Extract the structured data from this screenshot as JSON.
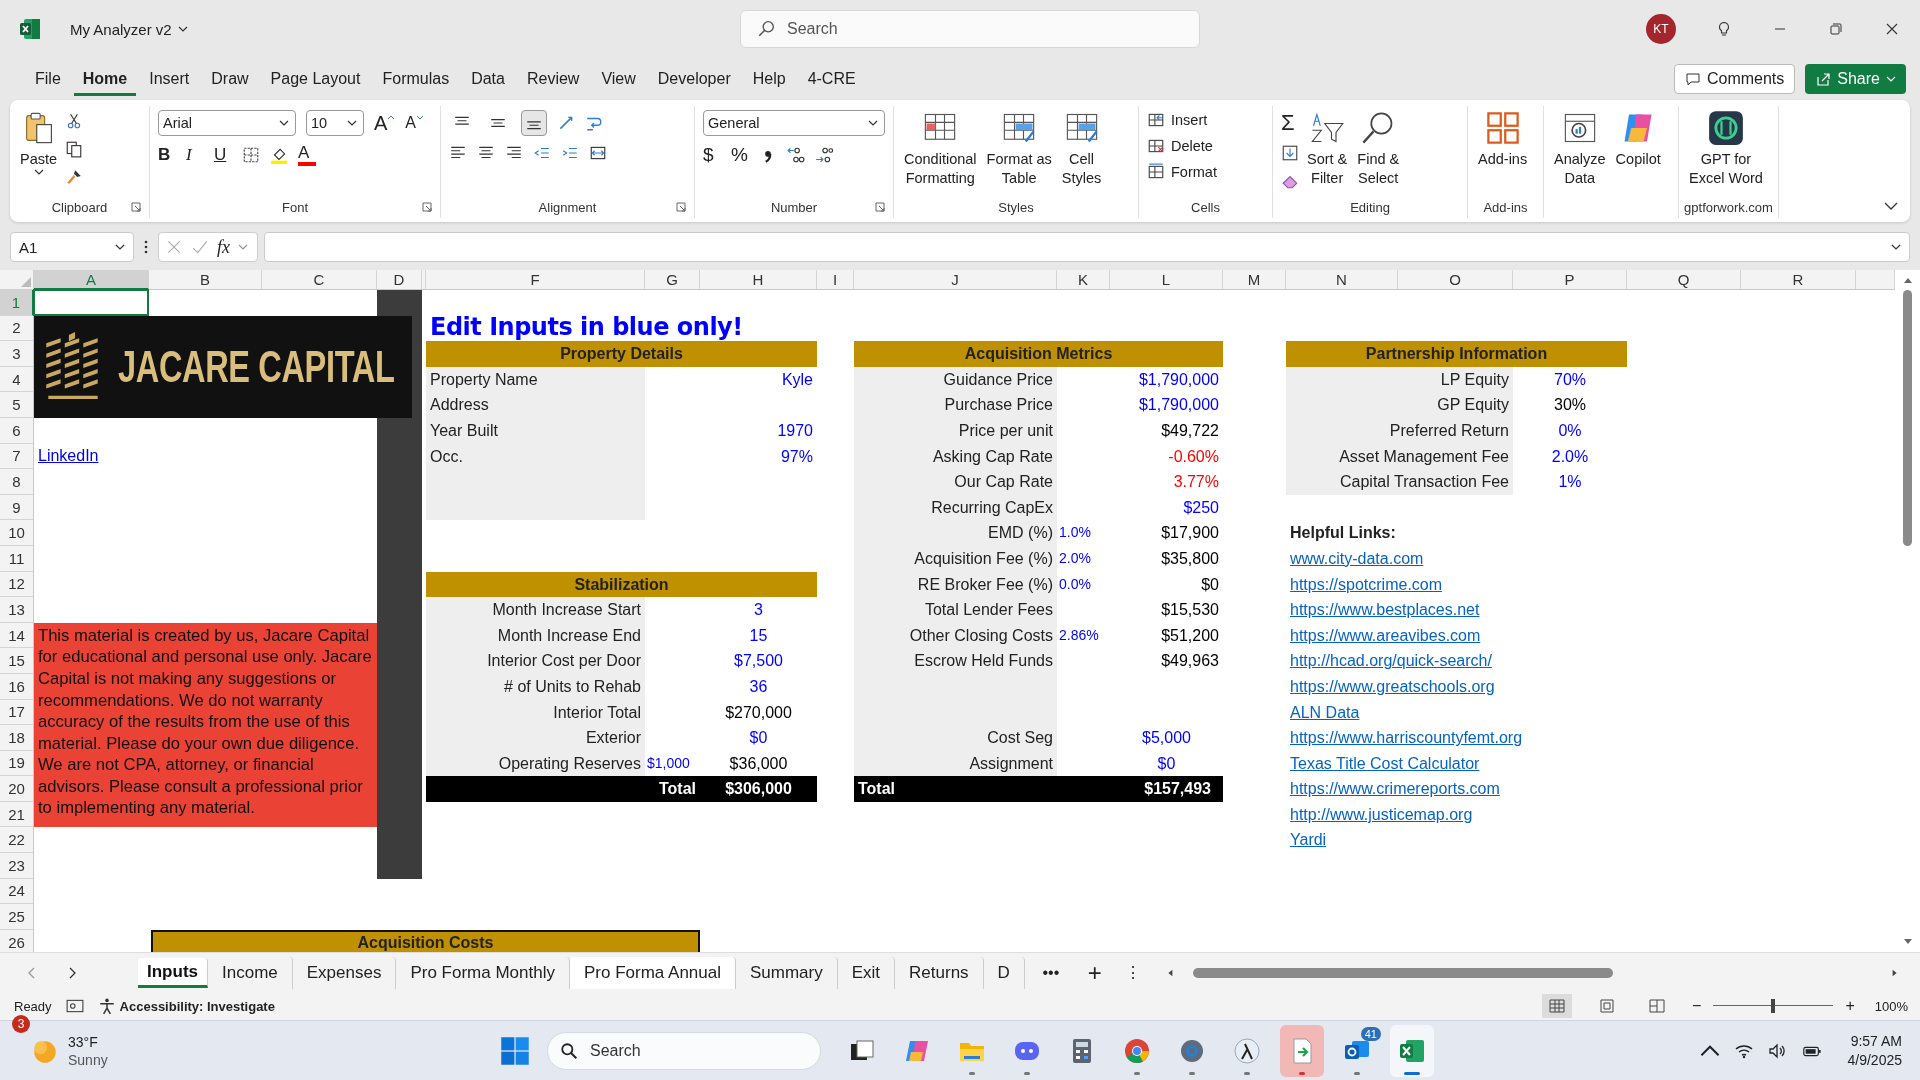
{
  "title_bar": {
    "file_name": "My Analyzer v2",
    "search_placeholder": "Search",
    "avatar": "KT"
  },
  "menu": [
    {
      "label": "File",
      "selected": false
    },
    {
      "label": "Home",
      "selected": true
    },
    {
      "label": "Insert",
      "selected": false
    },
    {
      "label": "Draw",
      "selected": false
    },
    {
      "label": "Page Layout",
      "selected": false
    },
    {
      "label": "Formulas",
      "selected": false
    },
    {
      "label": "Data",
      "selected": false
    },
    {
      "label": "Review",
      "selected": false
    },
    {
      "label": "View",
      "selected": false
    },
    {
      "label": "Developer",
      "selected": false
    },
    {
      "label": "Help",
      "selected": false
    },
    {
      "label": "4-CRE",
      "selected": false
    }
  ],
  "actions": {
    "comments": "Comments",
    "share": "Share"
  },
  "ribbon": {
    "clipboard": {
      "paste": "Paste",
      "label": "Clipboard"
    },
    "font": {
      "name": "Arial",
      "size": "10",
      "grow": "A",
      "shrink": "A",
      "styles": [
        "B",
        "I",
        "U"
      ],
      "font_color_glyph": "A",
      "label": "Font"
    },
    "alignment": {
      "vertical": [
        {
          "selected": false
        },
        {
          "selected": false
        },
        {
          "selected": true
        }
      ],
      "label": "Alignment"
    },
    "number": {
      "format": "General",
      "currency": "$",
      "percent": "%",
      "label": "Number"
    },
    "styles": {
      "buttons": [
        {
          "lines": [
            "Conditional",
            "Formatting"
          ]
        },
        {
          "lines": [
            "Format as",
            "Table"
          ]
        },
        {
          "lines": [
            "Cell",
            "Styles"
          ]
        }
      ],
      "label": "Styles"
    },
    "cells": {
      "buttons": [
        "Insert",
        "Delete",
        "Format"
      ],
      "label": "Cells"
    },
    "editing": {
      "sum": "Σ",
      "buttons": [
        {
          "lines": [
            "Sort &",
            "Filter"
          ]
        },
        {
          "lines": [
            "Find &",
            "Select"
          ]
        }
      ],
      "label": "Editing"
    },
    "addins": {
      "button": "Add-ins",
      "label": "Add-ins"
    },
    "ai": {
      "buttons": [
        {
          "lines": [
            "Analyze",
            "Data"
          ]
        },
        {
          "lines": [
            "Copilot"
          ]
        }
      ]
    },
    "gpt": {
      "lines": [
        "GPT for",
        "Excel Word"
      ],
      "label": "gptforwork.com"
    }
  },
  "formula_bar": {
    "name_box": "A1",
    "fx": "fx"
  },
  "columns": [
    {
      "label": "A",
      "selected": true
    },
    {
      "label": "B",
      "selected": false
    },
    {
      "label": "C",
      "selected": false
    },
    {
      "label": "D",
      "selected": false
    },
    {
      "label": "F",
      "selected": false
    },
    {
      "label": "G",
      "selected": false
    },
    {
      "label": "H",
      "selected": false
    },
    {
      "label": "I",
      "selected": false
    },
    {
      "label": "J",
      "selected": false
    },
    {
      "label": "K",
      "selected": false
    },
    {
      "label": "L",
      "selected": false
    },
    {
      "label": "M",
      "selected": false
    },
    {
      "label": "N",
      "selected": false
    },
    {
      "label": "O",
      "selected": false
    },
    {
      "label": "P",
      "selected": false
    },
    {
      "label": "Q",
      "selected": false
    },
    {
      "label": "R",
      "selected": false
    }
  ],
  "rows": [
    {
      "label": "1",
      "selected": true
    },
    {
      "label": "2",
      "selected": false
    },
    {
      "label": "3",
      "selected": false
    },
    {
      "label": "4",
      "selected": false
    },
    {
      "label": "5",
      "selected": false
    },
    {
      "label": "6",
      "selected": false
    },
    {
      "label": "7",
      "selected": false
    },
    {
      "label": "8",
      "selected": false
    },
    {
      "label": "9",
      "selected": false
    },
    {
      "label": "10",
      "selected": false
    },
    {
      "label": "11",
      "selected": false
    },
    {
      "label": "12",
      "selected": false
    },
    {
      "label": "13",
      "selected": false
    },
    {
      "label": "14",
      "selected": false
    },
    {
      "label": "15",
      "selected": false
    },
    {
      "label": "16",
      "selected": false
    },
    {
      "label": "17",
      "selected": false
    },
    {
      "label": "18",
      "selected": false
    },
    {
      "label": "19",
      "selected": false
    },
    {
      "label": "20",
      "selected": false
    },
    {
      "label": "21",
      "selected": false
    },
    {
      "label": "22",
      "selected": false
    },
    {
      "label": "23",
      "selected": false
    },
    {
      "label": "24",
      "selected": false
    },
    {
      "label": "25",
      "selected": false
    },
    {
      "label": "26",
      "selected": false
    }
  ],
  "sheet": {
    "logo": "JACARE CAPITAL",
    "link": "LinkedIn",
    "disclaimer": "This material is created by us, Jacare Capital for educational and personal use only. Jacare Capital is not making any suggestions or recommendations. We do not warranty accuracy of the results from the use of this material. Please do your own due diligence. We are not CPA, attorney, or financial advisors. Please consult a professional prior to implementing any material.",
    "heading": "Edit Inputs in blue only!",
    "property_details": {
      "title": "Property Details",
      "rows": [
        {
          "kind": "field",
          "label": "Property Name",
          "value": "Kyle",
          "color": "#0000ff"
        },
        {
          "kind": "field",
          "label": "Address"
        },
        {
          "kind": "field",
          "label": "Year Built",
          "value": "1970",
          "color": "#0000ff"
        },
        {
          "kind": "field",
          "label": "Occ.",
          "value": "97%",
          "color": "#0000ff"
        },
        {
          "kind": "blank"
        },
        {
          "kind": "blank"
        }
      ]
    },
    "stabilization": {
      "title": "Stabilization",
      "rows": [
        {
          "kind": "field",
          "label": "Month Increase Start",
          "value": "3",
          "color": "#0000ff"
        },
        {
          "kind": "field",
          "label": "Month Increase End",
          "value": "15",
          "color": "#0000ff"
        },
        {
          "kind": "field",
          "label": "Interior Cost per Door",
          "value": "$7,500",
          "color": "#0000ff"
        },
        {
          "kind": "field",
          "label": "# of Units to Rehab",
          "value": "36",
          "color": "#0000ff"
        },
        {
          "kind": "field",
          "label": "Interior Total",
          "value": "$270,000",
          "color": "#000000"
        },
        {
          "kind": "field",
          "label": "Exterior",
          "value": "$0",
          "color": "#0000ff"
        },
        {
          "kind": "field",
          "label": "Operating Reserves",
          "rate": "$1,000",
          "value": "$36,000",
          "color": "#000000"
        },
        {
          "kind": "total",
          "label": "Total",
          "value": "$306,000"
        }
      ]
    },
    "acquisition_metrics": {
      "title": "Acquisition Metrics",
      "rows": [
        {
          "kind": "field",
          "label": "Guidance Price",
          "value": "$1,790,000",
          "color": "#0000ff"
        },
        {
          "kind": "field",
          "label": "Purchase Price",
          "value": "$1,790,000",
          "color": "#0000ff"
        },
        {
          "kind": "field",
          "label": "Price per unit",
          "value": "$49,722",
          "color": "#000000"
        },
        {
          "kind": "field",
          "label": "Asking Cap Rate",
          "value": "-0.60%",
          "color": "#ff0000"
        },
        {
          "kind": "field",
          "label": "Our Cap Rate",
          "value": "3.77%",
          "color": "#ff0000"
        },
        {
          "kind": "field",
          "label": "Recurring CapEx",
          "value": "$250",
          "color": "#0000ff"
        },
        {
          "kind": "field",
          "label": "EMD (%)",
          "rate": "1.0%",
          "value": "$17,900",
          "color": "#000000"
        },
        {
          "kind": "field",
          "label": "Acquisition Fee (%)",
          "rate": "2.0%",
          "value": "$35,800",
          "color": "#000000"
        },
        {
          "kind": "field",
          "label": "RE Broker Fee (%)",
          "rate": "0.0%",
          "value": "$0",
          "color": "#000000"
        },
        {
          "kind": "field",
          "label": "Total Lender Fees",
          "value": "$15,530",
          "color": "#000000"
        },
        {
          "kind": "field",
          "label": "Other Closing Costs",
          "rate": "2.86%",
          "value": "$51,200",
          "color": "#000000"
        },
        {
          "kind": "field",
          "label": "Escrow Held Funds",
          "value": "$49,963",
          "color": "#000000"
        },
        {
          "kind": "blank"
        },
        {
          "kind": "blank"
        },
        {
          "kind": "centered",
          "label": "Cost Seg",
          "value": "$5,000",
          "color": "#0000ff"
        },
        {
          "kind": "centered",
          "label": "Assignment",
          "value": "$0",
          "color": "#0000ff"
        },
        {
          "kind": "total",
          "label": "Total",
          "value": "$157,493"
        }
      ]
    },
    "partnership": {
      "title": "Partnership Information",
      "rows": [
        {
          "kind": "field",
          "label": "LP Equity",
          "value": "70%",
          "color": "#0000ff"
        },
        {
          "kind": "field",
          "label": "GP Equity",
          "value": "30%",
          "color": "#000000"
        },
        {
          "kind": "field",
          "label": "Preferred Return",
          "value": "0%",
          "color": "#0000ff"
        },
        {
          "kind": "field",
          "label": "Asset Management Fee",
          "value": "2.0%",
          "color": "#0000ff"
        },
        {
          "kind": "field",
          "label": "Capital Transaction Fee",
          "value": "1%",
          "color": "#0000ff"
        }
      ]
    },
    "helpful_links": {
      "title": "Helpful Links:",
      "links": [
        "www.city-data.com",
        "https://spotcrime.com",
        "https://www.bestplaces.net",
        "https://www.areavibes.com",
        "http://hcad.org/quick-search/",
        "https://www.greatschools.org",
        "ALN Data",
        "https://www.harriscountyfemt.org",
        "Texas Title Cost Calculator",
        "https://www.crimereports.com",
        "http://www.justicemap.org",
        "Yardi"
      ]
    },
    "acquisition_costs": {
      "title": "Acquisition Costs"
    }
  },
  "sheet_tabs": [
    {
      "label": "Inputs",
      "selected": true,
      "highlighted": false
    },
    {
      "label": "Income",
      "selected": false,
      "highlighted": false
    },
    {
      "label": "Expenses",
      "selected": false,
      "highlighted": false
    },
    {
      "label": "Pro Forma Monthly",
      "selected": false,
      "highlighted": false
    },
    {
      "label": "Pro Forma Annual",
      "selected": false,
      "highlighted": true
    },
    {
      "label": "Summary",
      "selected": false,
      "highlighted": false
    },
    {
      "label": "Exit",
      "selected": false,
      "highlighted": false
    },
    {
      "label": "Returns",
      "selected": false,
      "highlighted": false
    },
    {
      "label": "D",
      "selected": false,
      "highlighted": false
    }
  ],
  "tab_controls": {
    "more": "•••",
    "add": "+",
    "options": "⋮"
  },
  "status_bar": {
    "ready": "Ready",
    "accessibility": "Accessibility: Investigate",
    "views": [
      {
        "selected": true
      },
      {
        "selected": false
      },
      {
        "selected": false
      }
    ],
    "zoom": {
      "minus": "−",
      "plus": "+",
      "level": 0.5,
      "reading": "100%"
    }
  },
  "taskbar": {
    "weather": {
      "badge": "3",
      "temp": "33°F",
      "condition": "Sunny"
    },
    "search_placeholder": "Search",
    "apps": [
      {
        "kind": "taskview",
        "running": false,
        "focused": false,
        "highlighted": false
      },
      {
        "kind": "copilot",
        "running": false,
        "focused": false,
        "highlighted": false
      },
      {
        "kind": "folder",
        "running": true,
        "focused": false,
        "highlighted": false
      },
      {
        "kind": "discord",
        "running": true,
        "focused": false,
        "highlighted": false
      },
      {
        "kind": "calculator",
        "running": false,
        "focused": false,
        "highlighted": false
      },
      {
        "kind": "chrome",
        "running": true,
        "focused": false,
        "highlighted": false
      },
      {
        "kind": "settings",
        "running": true,
        "focused": false,
        "highlighted": false
      },
      {
        "kind": "lambda",
        "running": true,
        "focused": false,
        "highlighted": false
      },
      {
        "kind": "document",
        "running": true,
        "focused": false,
        "highlighted": true
      },
      {
        "kind": "mail",
        "running": true,
        "focused": false,
        "highlighted": false,
        "badge": "41"
      },
      {
        "kind": "excel",
        "running": true,
        "focused": true,
        "highlighted": false
      }
    ],
    "time": "9:57 AM",
    "date": "4/9/2025"
  }
}
